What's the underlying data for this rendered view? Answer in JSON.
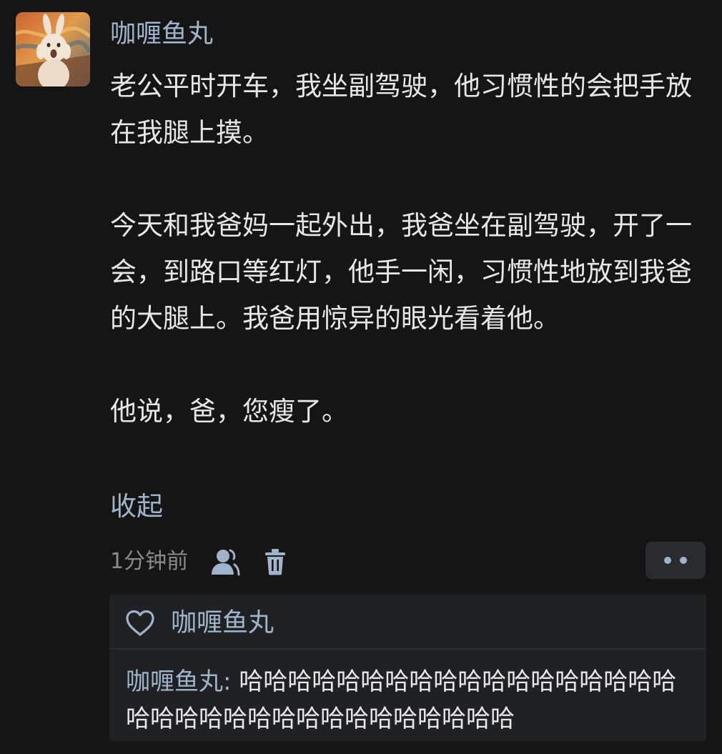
{
  "post": {
    "author": "咖喱鱼丸",
    "avatar_icon": "scream-rabbit-avatar",
    "paragraphs": [
      "老公平时开车，我坐副驾驶，他习惯性的会把手放在我腿上摸。",
      "",
      "今天和我爸妈一起外出，我爸坐在副驾驶，开了一会，到路口等红灯，他手一闲，习惯性地放到我爸的大腿上。我爸用惊异的眼光看着他。",
      "",
      "他说，爸，您瘦了。"
    ],
    "collapse_label": "收起",
    "timestamp": "1分钟前",
    "icons": {
      "user": "user-icon",
      "delete": "trash-icon",
      "more": "more-dots-icon"
    }
  },
  "replies": {
    "like_icon": "heart-icon",
    "liked_by": "咖喱鱼丸",
    "comment": {
      "author": "咖喱鱼丸",
      "separator": ": ",
      "text": "哈哈哈哈哈哈哈哈哈哈哈哈哈哈哈哈哈哈哈哈哈哈哈哈哈哈哈哈哈哈哈哈哈哈"
    }
  },
  "colors": {
    "background": "#151515",
    "accent": "#9fb3cb",
    "text": "#e7e7e7",
    "muted": "#8a8a8a",
    "panel": "#202123"
  }
}
